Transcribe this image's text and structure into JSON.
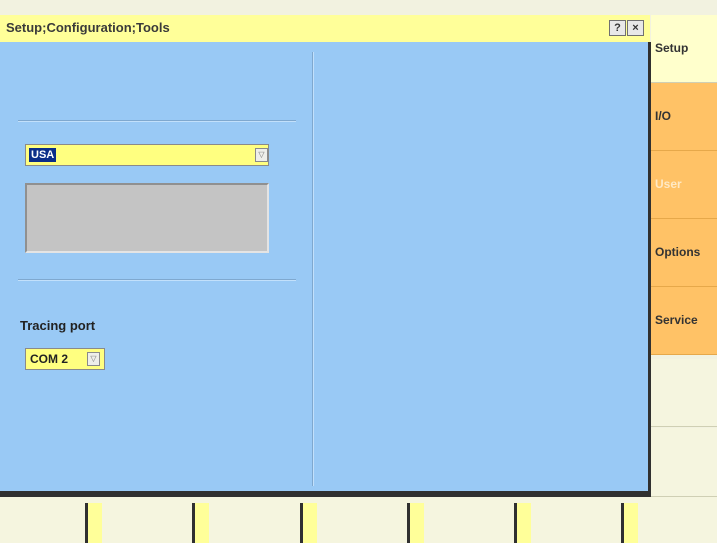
{
  "window": {
    "title": "Setup;Configuration;Tools",
    "help_label": "?",
    "close_label": "×"
  },
  "country": {
    "value": "USA",
    "arrow": "▽"
  },
  "tracing": {
    "label": "Tracing port",
    "value": "COM 2",
    "arrow": "▽"
  },
  "side_tabs": [
    "Setup",
    "I/O",
    "User",
    "Options",
    "Service"
  ],
  "colors": {
    "title_bar": "#ffff99",
    "panel": "#99c9f5",
    "tab_active": "#ffffcc",
    "tab_orange": "#ffc266",
    "select_field": "#ffff80",
    "selection_highlight": "#0b2e88"
  }
}
